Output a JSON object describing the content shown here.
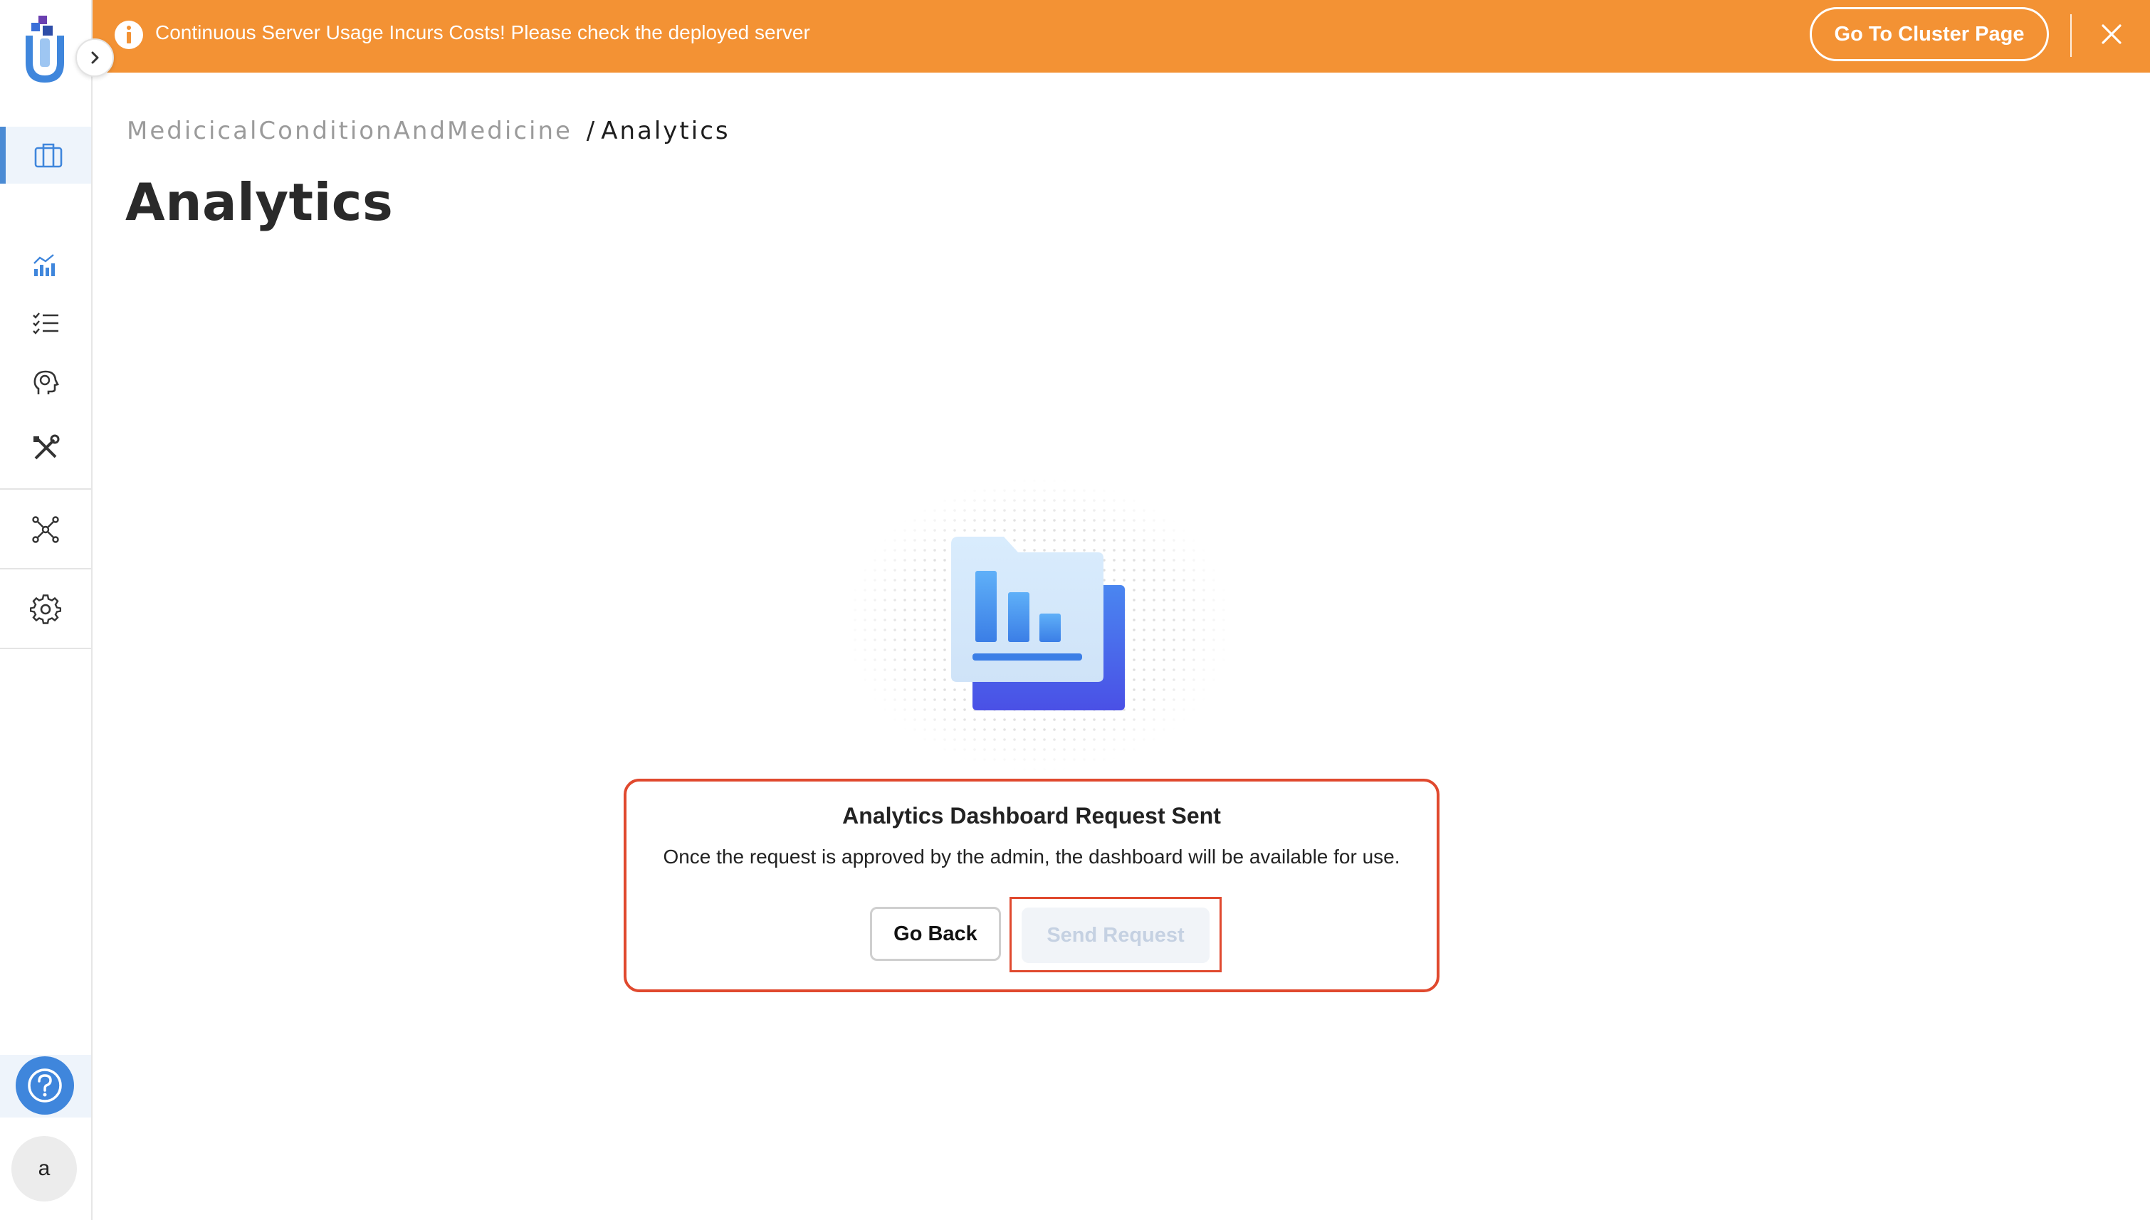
{
  "banner": {
    "message": "Continuous Server Usage Incurs Costs! Please check the deployed server",
    "cluster_button": "Go To Cluster Page",
    "info_icon": "info-icon",
    "close_icon": "close-icon",
    "background_color": "#f39234"
  },
  "sidebar": {
    "items": [
      {
        "icon": "briefcase-icon",
        "active": true
      },
      {
        "icon": "analytics-chart-icon",
        "active": false
      },
      {
        "icon": "checklist-icon",
        "active": false
      },
      {
        "icon": "brain-head-icon",
        "active": false
      },
      {
        "icon": "tools-icon",
        "active": false
      },
      {
        "icon": "network-nodes-icon",
        "active": false
      },
      {
        "icon": "gear-icon",
        "active": false
      }
    ],
    "help_icon": "help-icon",
    "avatar_initial": "a",
    "accent_color": "#4b8bd4"
  },
  "breadcrumb": {
    "root": "MedicicalConditionAndMedicine",
    "separator": "/",
    "current": "Analytics"
  },
  "page": {
    "title": "Analytics"
  },
  "request_card": {
    "title": "Analytics Dashboard Request Sent",
    "message": "Once the request is approved by the admin, the dashboard will be available for use.",
    "go_back_label": "Go Back",
    "send_request_label": "Send Request",
    "highlight_color": "#e0492e"
  }
}
